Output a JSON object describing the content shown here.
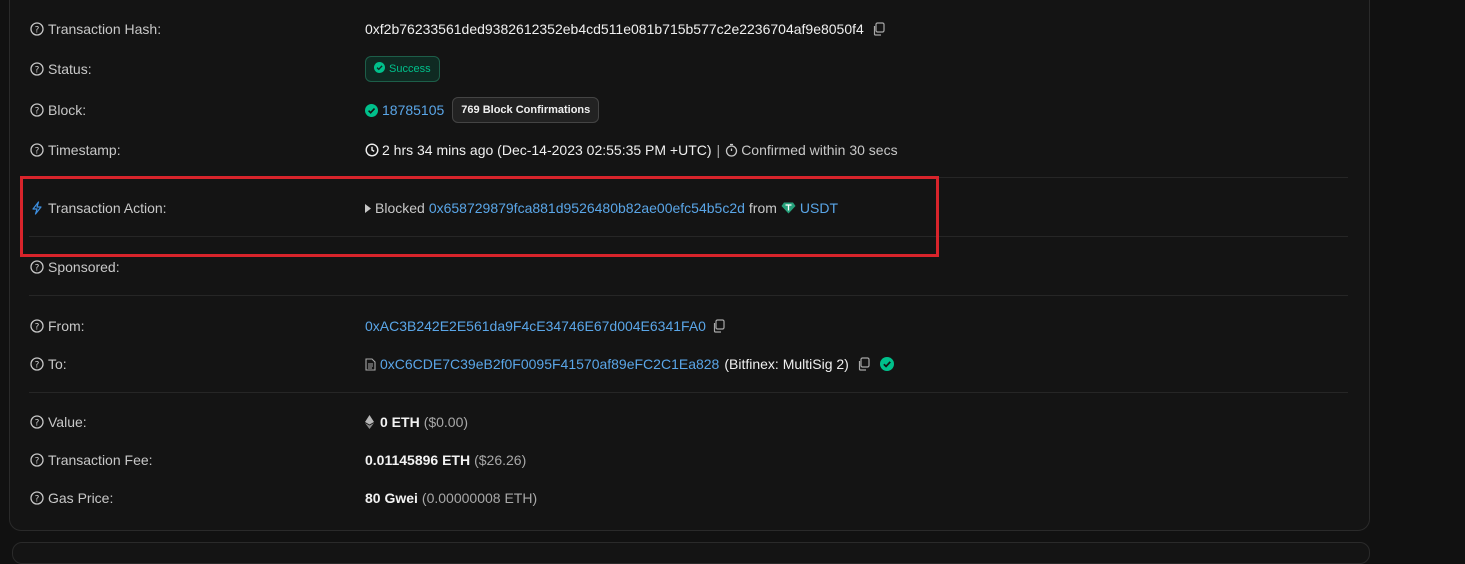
{
  "rows": {
    "tx_hash": {
      "label": "Transaction Hash:",
      "value": "0xf2b76233561ded9382612352eb4cd511e081b715b577c2e2236704af9e8050f4"
    },
    "status": {
      "label": "Status:",
      "badge": "Success"
    },
    "block": {
      "label": "Block:",
      "number": "18785105",
      "confirmations": "769 Block Confirmations"
    },
    "timestamp": {
      "label": "Timestamp:",
      "ago": "2 hrs 34 mins ago (Dec-14-2023 02:55:35 PM +UTC)",
      "separator": "|",
      "confirmed": "Confirmed within 30 secs"
    },
    "action": {
      "label": "Transaction Action:",
      "verb": "Blocked",
      "address": "0x658729879fca881d9526480b82ae00efc54b5c2d",
      "from_word": "from",
      "token": "USDT"
    },
    "sponsored": {
      "label": "Sponsored:"
    },
    "from": {
      "label": "From:",
      "address": "0xAC3B242E2E561da9F4cE34746E67d004E6341FA0"
    },
    "to": {
      "label": "To:",
      "address": "0xC6CDE7C39eB2f0F0095F41570af89eFC2C1Ea828",
      "name": "(Bitfinex: MultiSig 2)"
    },
    "value": {
      "label": "Value:",
      "amount": "0 ETH",
      "usd": "($0.00)"
    },
    "fee": {
      "label": "Transaction Fee:",
      "amount": "0.01145896 ETH",
      "usd": "($26.26)"
    },
    "gas": {
      "label": "Gas Price:",
      "amount": "80 Gwei",
      "eth": "(0.00000008 ETH)"
    }
  },
  "colors": {
    "accent_link": "#5aa6e8",
    "success": "#00c08b",
    "highlight": "#d8242b"
  }
}
